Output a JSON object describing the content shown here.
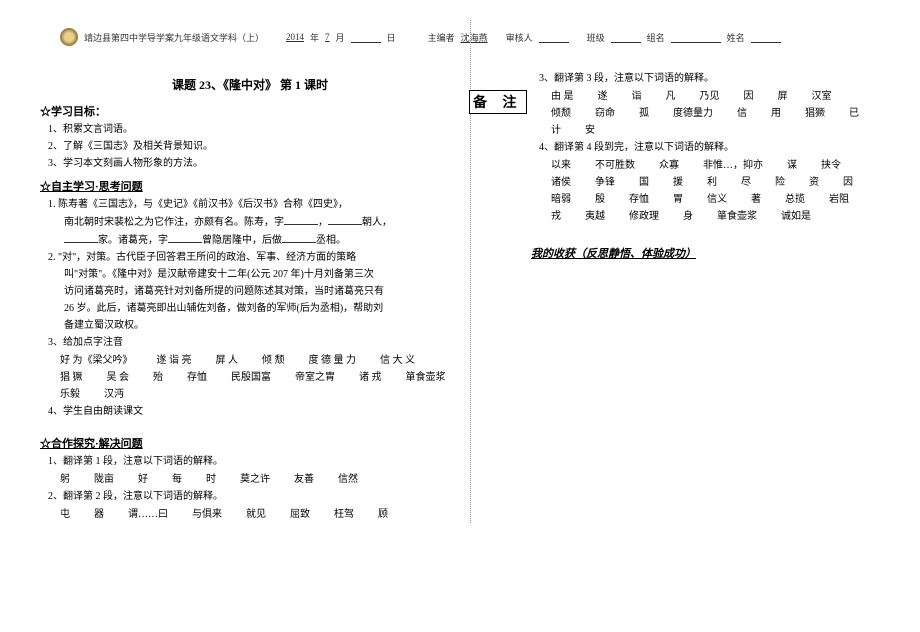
{
  "header": {
    "school": "靖边县第四中学导学案九年级语文学科（上）",
    "date_prefix": "2014",
    "date_y": "年",
    "date_m_val": "7",
    "date_m": "月",
    "date_d": "日",
    "editor_label": "主编者",
    "editor": "沈海燕",
    "reviewer_label": "审核人",
    "class_label": "班级",
    "group_label": "组名",
    "name_label": "姓名"
  },
  "title": "课题  23、《隆中对》   第 1 课时",
  "sec1": {
    "head": "☆学习目标：",
    "i1": "1、积累文言词语。",
    "i2": "2、了解《三国志》及相关背景知识。",
    "i3": "3、学习本文刻画人物形象的方法。"
  },
  "sec2": {
    "head": "☆自主学习·思考问题",
    "i1a": "1.  陈寿著《三国志》，与《史记》《前汉书》《后汉书》合称《四史》，",
    "i1b": "南北朝时宋裴松之为它作注，亦颇有名。陈寿，字",
    "i1c": "，",
    "i1d": "朝人，",
    "i1e": "家。诸葛亮，字",
    "i1f": "曾隐居隆中，后做",
    "i1g": "丞相。",
    "i2a": "2.  \"对\"，对策。古代臣子回答君王所问的政治、军事、经济方面的策略",
    "i2b": "叫\"对策\"。《隆中对》是汉献帝建安十二年(公元 207 年)十月刘备第三次",
    "i2c": "访问诸葛亮时，诸葛亮针对刘备所提的问题陈述其对策，当时诸葛亮只有",
    "i2d": "26 岁。此后，诸葛亮即出山辅佐刘备，做刘备的军师(后为丞相)，帮助刘",
    "i2e": "备建立蜀汉政权。",
    "i3": "3、给加点字注音",
    "w3": [
      "好 为《梁父吟》",
      "遂 诣 亮",
      "屏 人",
      "倾 颓",
      "度 德 量 力",
      "信 大 义",
      "猖 獗",
      "吴 会",
      "殆",
      "存恤",
      "民殷国富",
      "帝室之胄",
      "诸 戎",
      "箪食壶浆",
      "乐毅",
      "汉沔"
    ],
    "i4": "4、学生自由朗读课文"
  },
  "sec3": {
    "head": "☆合作探究·解决问题",
    "i1": "1、翻译第 1 段，注意以下词语的解释。",
    "w1": [
      "躬",
      "陇亩",
      "好",
      "每",
      "时",
      "莫之许",
      "友善",
      "信然"
    ],
    "i2": "2、翻译第 2 段，注意以下词语的解释。",
    "w2": [
      "屯",
      "器",
      "谓……曰",
      "与俱来",
      "就见",
      "屈致",
      "枉驾",
      "顾"
    ]
  },
  "right": {
    "beizhu": "备 注",
    "i3": "3、翻译第 3 段，注意以下词语的解释。",
    "w3": [
      "由 是",
      "遂",
      "诣",
      "凡",
      "乃见",
      "因",
      "屏",
      "汉室",
      "倾颓",
      "窃命",
      "孤",
      "度德量力",
      "信",
      "用",
      "猖獗",
      "已",
      "计",
      "安"
    ],
    "i4": "4、翻译第 4 段到完，注意以下词语的解释。",
    "w4": [
      "以来",
      "不可胜数",
      "众寡",
      "非惟…，抑亦",
      "谋",
      "挟令",
      "诸侯",
      "争锋",
      "国",
      "援",
      "利",
      "尽",
      "险",
      "资",
      "因",
      "暗弱",
      "殷",
      "存恤",
      "胃",
      "信义",
      "著",
      "总揽",
      "岩阻",
      "戎",
      "夷越",
      "修政理",
      "身",
      "箪食壶浆",
      "诚如是"
    ],
    "harvest": "我的收获（反思静悟、体验成功）"
  }
}
